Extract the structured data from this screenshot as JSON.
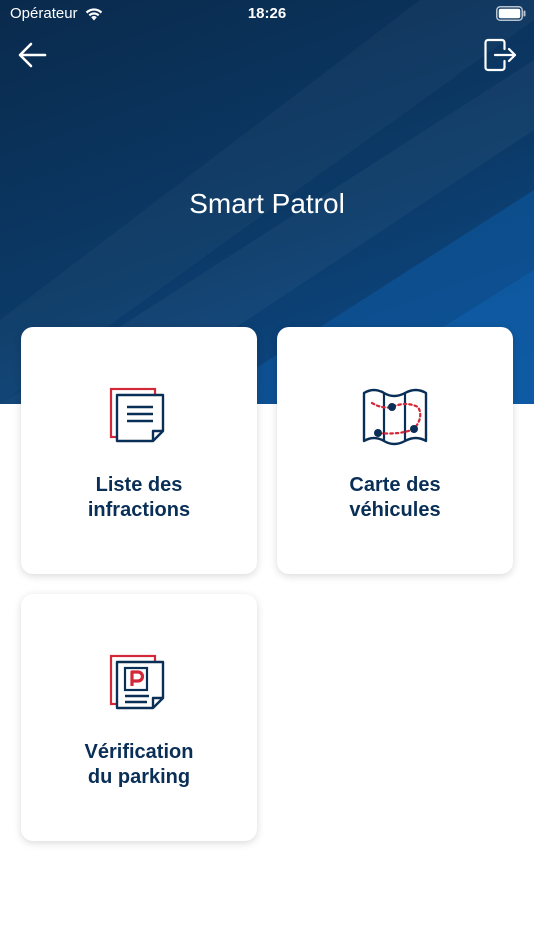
{
  "status_bar": {
    "carrier": "Opérateur",
    "time": "18:26"
  },
  "header": {
    "title": "Smart Patrol"
  },
  "tiles": [
    {
      "line1": "Liste des",
      "line2": "infractions",
      "icon": "documents-icon"
    },
    {
      "line1": "Carte des",
      "line2": "véhicules",
      "icon": "route-map-icon"
    },
    {
      "line1": "Vérification",
      "line2": "du parking",
      "icon": "parking-ticket-icon"
    }
  ],
  "colors": {
    "header_dark": "#0a2a4c",
    "header_light": "#0d4d8e",
    "label_navy": "#0a2f57",
    "accent_red": "#d2283a"
  }
}
